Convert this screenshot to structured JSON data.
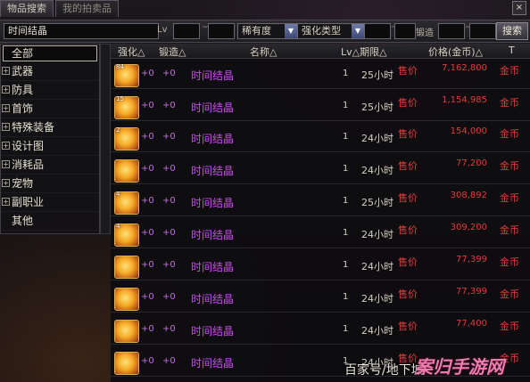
{
  "tabs": [
    {
      "label": "物品搜索",
      "active": true
    },
    {
      "label": "我的拍卖品",
      "active": false
    }
  ],
  "close_label": "×",
  "search": {
    "item_name": "时间结晶",
    "lv_label": "Lv",
    "tilde": "~",
    "rarity_label": "稀有度",
    "enhance_type_label": "强化类型",
    "forge_label": "锻造",
    "search_button": "搜索"
  },
  "categories": [
    {
      "label": "全部",
      "selected": true,
      "expandable": false
    },
    {
      "label": "武器",
      "expandable": true
    },
    {
      "label": "防具",
      "expandable": true
    },
    {
      "label": "首饰",
      "expandable": true
    },
    {
      "label": "特殊装备",
      "expandable": true
    },
    {
      "label": "设计图",
      "expandable": true
    },
    {
      "label": "消耗品",
      "expandable": true
    },
    {
      "label": "宠物",
      "expandable": true
    },
    {
      "label": "副职业",
      "expandable": true
    },
    {
      "label": "其他",
      "expandable": false
    }
  ],
  "headers": {
    "enhance": "强化△",
    "forge": "锻造△",
    "name": "名称△",
    "lv_duration": "Lv△期限△",
    "price": "价格(金币)△"
  },
  "rows": [
    {
      "count": "84",
      "enhance": "+0",
      "forge": "+0",
      "name": "时间结晶",
      "lv": "1",
      "duration": "25小时",
      "status": "售价",
      "price": "7,162,800",
      "currency": "金币"
    },
    {
      "count": "15",
      "enhance": "+0",
      "forge": "+0",
      "name": "时间结晶",
      "lv": "1",
      "duration": "25小时",
      "status": "售价",
      "price": "1,154,985",
      "currency": "金币"
    },
    {
      "count": "2",
      "enhance": "+0",
      "forge": "+0",
      "name": "时间结晶",
      "lv": "1",
      "duration": "24小时",
      "status": "售价",
      "price": "154,000",
      "currency": "金币"
    },
    {
      "count": "",
      "enhance": "+0",
      "forge": "+0",
      "name": "时间结晶",
      "lv": "1",
      "duration": "24小时",
      "status": "售价",
      "price": "77,200",
      "currency": "金币"
    },
    {
      "count": "4",
      "enhance": "+0",
      "forge": "+0",
      "name": "时间结晶",
      "lv": "1",
      "duration": "25小时",
      "status": "售价",
      "price": "308,892",
      "currency": "金币"
    },
    {
      "count": "4",
      "enhance": "+0",
      "forge": "+0",
      "name": "时间结晶",
      "lv": "1",
      "duration": "24小时",
      "status": "售价",
      "price": "309,200",
      "currency": "金币"
    },
    {
      "count": "",
      "enhance": "+0",
      "forge": "+0",
      "name": "时间结晶",
      "lv": "1",
      "duration": "24小时",
      "status": "售价",
      "price": "77,399",
      "currency": "金币"
    },
    {
      "count": "",
      "enhance": "+0",
      "forge": "+0",
      "name": "时间结晶",
      "lv": "1",
      "duration": "24小时",
      "status": "售价",
      "price": "77,399",
      "currency": "金币"
    },
    {
      "count": "",
      "enhance": "+0",
      "forge": "+0",
      "name": "时间结晶",
      "lv": "1",
      "duration": "24小时",
      "status": "售价",
      "price": "77,400",
      "currency": "金币"
    },
    {
      "count": "",
      "enhance": "+0",
      "forge": "+0",
      "name": "时间结晶",
      "lv": "1",
      "duration": "24小时",
      "status": "售价",
      "price": "",
      "currency": "金币"
    }
  ],
  "watermark": "百家号/地下城",
  "logo_text": "案归手游网",
  "colors": {
    "price_red": "#e23c3c",
    "name_purple": "#c94cf0"
  }
}
